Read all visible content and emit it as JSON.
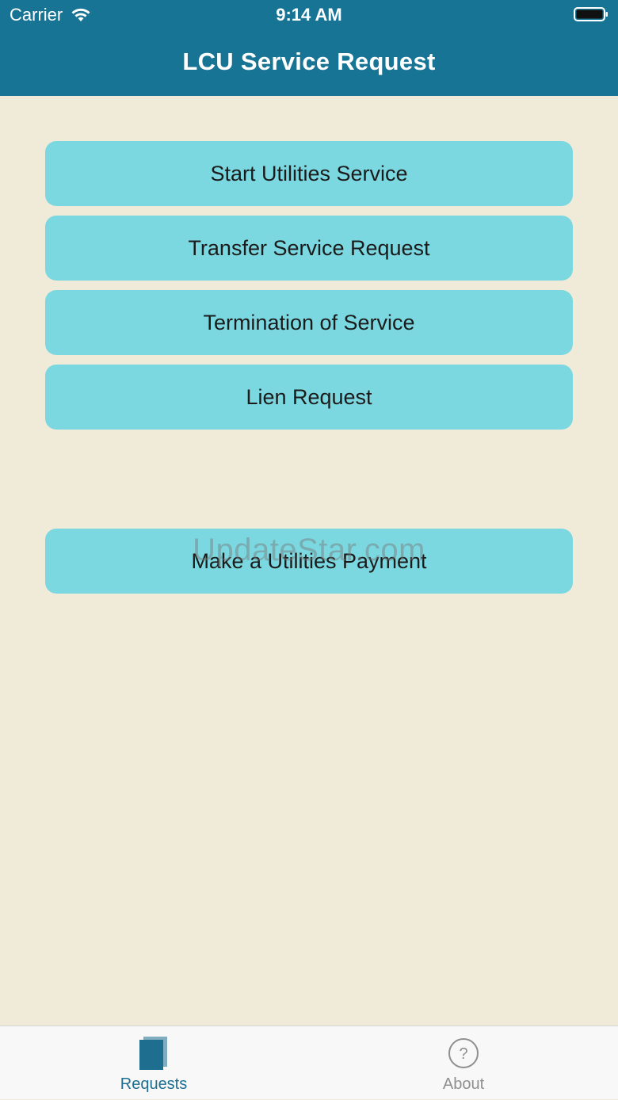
{
  "status_bar": {
    "carrier": "Carrier",
    "time": "9:14 AM"
  },
  "nav": {
    "title": "LCU Service Request"
  },
  "buttons": {
    "start_service": "Start Utilities Service",
    "transfer_service": "Transfer Service Request",
    "termination": "Termination of Service",
    "lien_request": "Lien Request",
    "make_payment": "Make a Utilities Payment"
  },
  "watermark": "UpdateStar.com",
  "tabbar": {
    "requests": "Requests",
    "about": "About"
  },
  "colors": {
    "header": "#187494",
    "background": "#f0ead8",
    "button": "#7bd8e0",
    "tab_active": "#1d6e8f",
    "tab_inactive": "#8f8f8f"
  }
}
